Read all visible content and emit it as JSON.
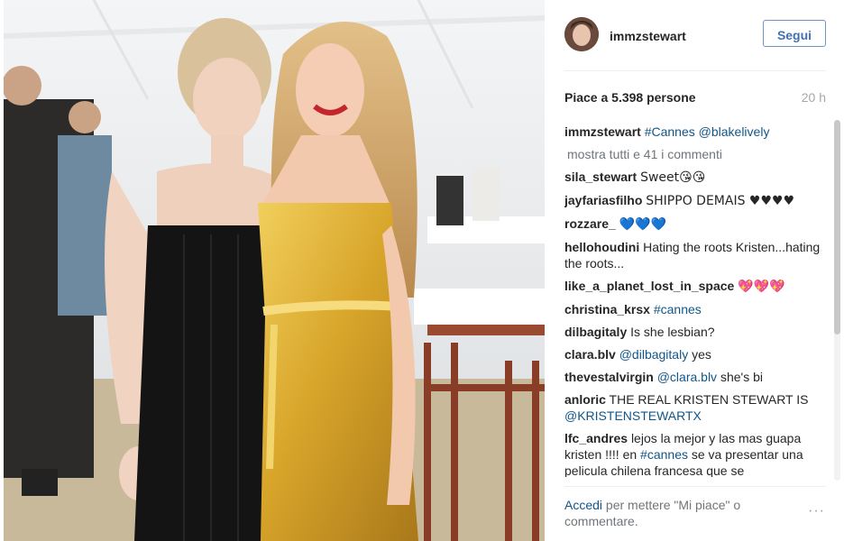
{
  "post": {
    "username": "immzstewart",
    "follow_label": "Segui",
    "likes_text": "Piace a 5.398 persone",
    "time_ago": "20 h"
  },
  "caption": {
    "username": "immzstewart",
    "hashtag": "#Cannes",
    "mention": "@blakelively"
  },
  "show_all_comments": "mostra tutti e 41 i commenti",
  "comments": [
    {
      "user": "sila_stewart",
      "text": "Sweet😘😘"
    },
    {
      "user": "jayfariasfilho",
      "text": "SHIPPO DEMAIS ♥♥♥♥"
    },
    {
      "user": "rozzare_",
      "text": "💙💙💙"
    },
    {
      "user": "hellohoudini",
      "text": "Hating the roots Kristen...hating the roots..."
    },
    {
      "user": "like_a_planet_lost_in_space",
      "text": "💖💖💖"
    },
    {
      "user": "christina_krsx",
      "link": "#cannes"
    },
    {
      "user": "dilbagitaly",
      "text": "Is she lesbian?"
    },
    {
      "user": "clara.blv",
      "link": "@dilbagitaly",
      "text": "yes"
    },
    {
      "user": "thevestalvirgin",
      "link": "@clara.blv",
      "text": "she's bi"
    },
    {
      "user": "anloric",
      "text": "THE REAL KRISTEN STEWART IS",
      "link_after": "@KRISTENSTEWARTX"
    },
    {
      "user": "lfc_andres",
      "text": "lejos la mejor y las mas guapa kristen !!!! en",
      "link_after": "#cannes",
      "text_after": "se va presentar una pelicula chilena francesa que se"
    }
  ],
  "footer": {
    "login_label": "Accedi",
    "rest": "per mettere \"Mi piace\" o commentare.",
    "more_options": "···"
  },
  "colors": {
    "link": "#125688",
    "follow_border": "#6f97c6",
    "follow_text": "#3f72af",
    "muted": "#70757a"
  }
}
